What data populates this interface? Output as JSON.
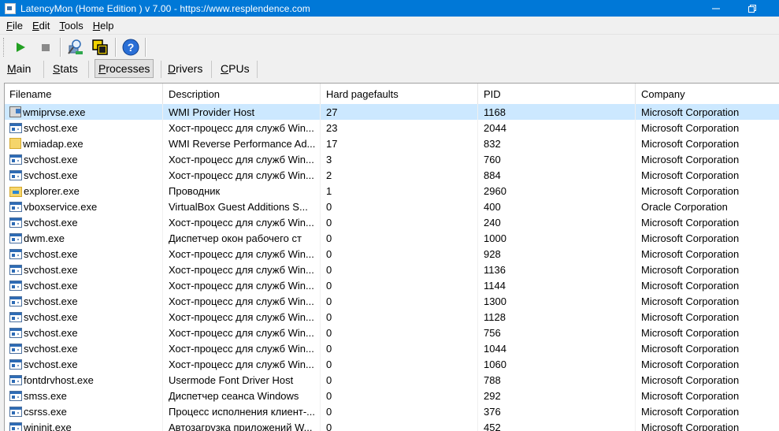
{
  "window": {
    "title": "LatencyMon  (Home Edition )  v 7.00 - https://www.resplendence.com",
    "icon": "app-window-icon"
  },
  "menu": [
    "File",
    "Edit",
    "Tools",
    "Help"
  ],
  "toolbar": {
    "buttons": [
      {
        "name": "start-icon",
        "color": "#22a022"
      },
      {
        "name": "stop-icon",
        "color": "#8a8a8a"
      },
      {
        "name": "analyze-icon"
      },
      {
        "name": "windows-icon"
      },
      {
        "name": "help-icon",
        "color": "#2a6fd6"
      }
    ]
  },
  "tabs": [
    "Main",
    "Stats",
    "Processes",
    "Drivers",
    "CPUs"
  ],
  "active_tab": "Processes",
  "table": {
    "columns": [
      "Filename",
      "Description",
      "Hard pagefaults",
      "PID",
      "Company"
    ],
    "rows": [
      {
        "icon": "wmi",
        "filename": "wmiprvse.exe",
        "description": "WMI Provider Host",
        "pagefaults": "27",
        "pid": "1168",
        "company": "Microsoft Corporation",
        "selected": true
      },
      {
        "icon": "svchost",
        "filename": "svchost.exe",
        "description": "Хост-процесс для служб Win...",
        "pagefaults": "23",
        "pid": "2044",
        "company": "Microsoft Corporation"
      },
      {
        "icon": "folder",
        "filename": "wmiadap.exe",
        "description": "WMI Reverse Performance Ad...",
        "pagefaults": "17",
        "pid": "832",
        "company": "Microsoft Corporation"
      },
      {
        "icon": "svchost",
        "filename": "svchost.exe",
        "description": "Хост-процесс для служб Win...",
        "pagefaults": "3",
        "pid": "760",
        "company": "Microsoft Corporation"
      },
      {
        "icon": "svchost",
        "filename": "svchost.exe",
        "description": "Хост-процесс для служб Win...",
        "pagefaults": "2",
        "pid": "884",
        "company": "Microsoft Corporation"
      },
      {
        "icon": "explorer",
        "filename": "explorer.exe",
        "description": "Проводник",
        "pagefaults": "1",
        "pid": "2960",
        "company": "Microsoft Corporation"
      },
      {
        "icon": "svchost",
        "filename": "vboxservice.exe",
        "description": "VirtualBox Guest Additions S...",
        "pagefaults": "0",
        "pid": "400",
        "company": "Oracle Corporation"
      },
      {
        "icon": "svchost",
        "filename": "svchost.exe",
        "description": "Хост-процесс для служб Win...",
        "pagefaults": "0",
        "pid": "240",
        "company": "Microsoft Corporation"
      },
      {
        "icon": "svchost",
        "filename": "dwm.exe",
        "description": "Диспетчер окон рабочего ст",
        "pagefaults": "0",
        "pid": "1000",
        "company": "Microsoft Corporation"
      },
      {
        "icon": "svchost",
        "filename": "svchost.exe",
        "description": "Хост-процесс для служб Win...",
        "pagefaults": "0",
        "pid": "928",
        "company": "Microsoft Corporation"
      },
      {
        "icon": "svchost",
        "filename": "svchost.exe",
        "description": "Хост-процесс для служб Win...",
        "pagefaults": "0",
        "pid": "1136",
        "company": "Microsoft Corporation"
      },
      {
        "icon": "svchost",
        "filename": "svchost.exe",
        "description": "Хост-процесс для служб Win...",
        "pagefaults": "0",
        "pid": "1144",
        "company": "Microsoft Corporation"
      },
      {
        "icon": "svchost",
        "filename": "svchost.exe",
        "description": "Хост-процесс для служб Win...",
        "pagefaults": "0",
        "pid": "1300",
        "company": "Microsoft Corporation"
      },
      {
        "icon": "svchost",
        "filename": "svchost.exe",
        "description": "Хост-процесс для служб Win...",
        "pagefaults": "0",
        "pid": "1128",
        "company": "Microsoft Corporation"
      },
      {
        "icon": "svchost",
        "filename": "svchost.exe",
        "description": "Хост-процесс для служб Win...",
        "pagefaults": "0",
        "pid": "756",
        "company": "Microsoft Corporation"
      },
      {
        "icon": "svchost",
        "filename": "svchost.exe",
        "description": "Хост-процесс для служб Win...",
        "pagefaults": "0",
        "pid": "1044",
        "company": "Microsoft Corporation"
      },
      {
        "icon": "svchost",
        "filename": "svchost.exe",
        "description": "Хост-процесс для служб Win...",
        "pagefaults": "0",
        "pid": "1060",
        "company": "Microsoft Corporation"
      },
      {
        "icon": "svchost",
        "filename": "fontdrvhost.exe",
        "description": "Usermode Font Driver Host",
        "pagefaults": "0",
        "pid": "788",
        "company": "Microsoft Corporation"
      },
      {
        "icon": "svchost",
        "filename": "smss.exe",
        "description": "Диспетчер сеанса  Windows",
        "pagefaults": "0",
        "pid": "292",
        "company": "Microsoft Corporation"
      },
      {
        "icon": "svchost",
        "filename": "csrss.exe",
        "description": "Процесс исполнения клиент-...",
        "pagefaults": "0",
        "pid": "376",
        "company": "Microsoft Corporation"
      },
      {
        "icon": "svchost",
        "filename": "wininit.exe",
        "description": "Автозагрузка приложений W...",
        "pagefaults": "0",
        "pid": "452",
        "company": "Microsoft Corporation"
      }
    ]
  }
}
